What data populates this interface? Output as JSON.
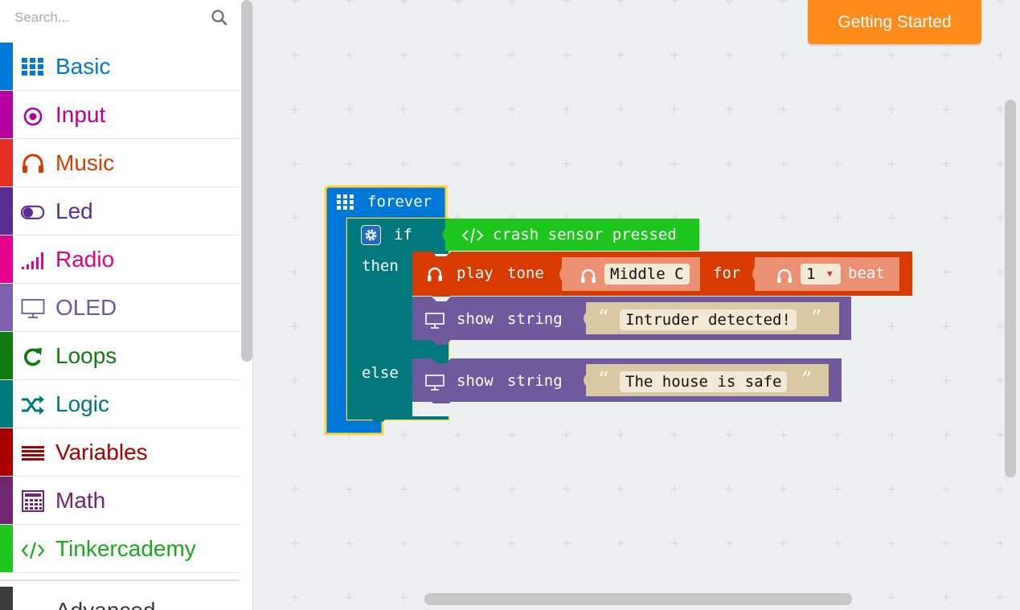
{
  "search": {
    "placeholder": "Search..."
  },
  "toolbox": {
    "categories": [
      {
        "label": "Basic",
        "color": "#1e90ff",
        "icon": "grid-icon"
      },
      {
        "label": "Input",
        "color": "#d400d4",
        "icon": "target-icon"
      },
      {
        "label": "Music",
        "color": "#e63022",
        "icon": "headphones-icon"
      },
      {
        "label": "Led",
        "color": "#5c2d91",
        "icon": "toggle-icon"
      },
      {
        "label": "Radio",
        "color": "#e3008c",
        "icon": "signal-bars-icon"
      },
      {
        "label": "OLED",
        "color": "#7f60b1",
        "icon": "monitor-icon"
      },
      {
        "label": "Loops",
        "color": "#107c10",
        "icon": "loop-arrow-icon"
      },
      {
        "label": "Logic",
        "color": "#00787c",
        "icon": "shuffle-icon"
      },
      {
        "label": "Variables",
        "color": "#a80000",
        "icon": "list-lines-icon"
      },
      {
        "label": "Math",
        "color": "#712672",
        "icon": "calculator-icon"
      },
      {
        "label": "Tinkercademy",
        "color": "#1ec51e",
        "icon": "code-brackets-icon"
      }
    ],
    "advanced_label": "Advanced"
  },
  "header": {
    "getting_started": "Getting Started"
  },
  "blocks": {
    "forever": "forever",
    "if": "if",
    "then": "then",
    "else": "else",
    "condition": "crash sensor pressed",
    "play": "play",
    "tone": "tone",
    "tone_value": "Middle C",
    "for": "for",
    "beat_value": "1",
    "beat": "beat",
    "show1": "show",
    "string1": "string",
    "text1": "Intruder detected!",
    "show2": "show",
    "string2": "string",
    "text2": "The house is safe",
    "open_quote": "“",
    "close_quote": "”"
  }
}
